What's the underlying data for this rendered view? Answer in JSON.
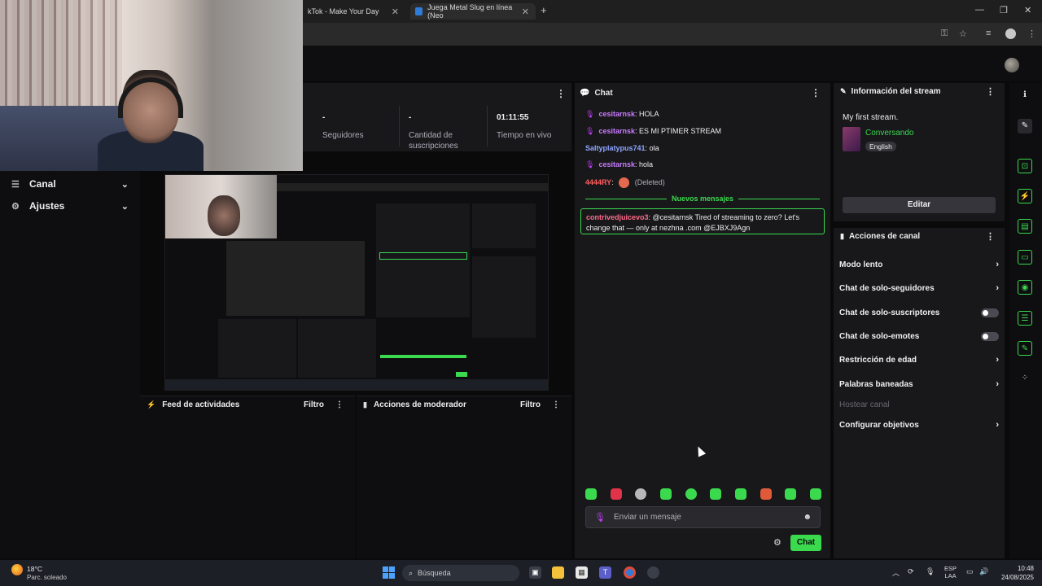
{
  "browser": {
    "tabs": [
      {
        "label": "kTok - Make Your Day"
      },
      {
        "label": "Juega Metal Slug en línea (Neo"
      }
    ],
    "new_tab": "+",
    "close_glyph": "✕",
    "controls": {
      "minimize": "—",
      "maximize": "❐",
      "close": "✕"
    }
  },
  "left_sidebar": {
    "items": [
      {
        "label": "Canal",
        "icon": "channel-icon"
      },
      {
        "label": "Ajustes",
        "icon": "settings-icon"
      }
    ]
  },
  "stats": {
    "items": [
      {
        "value": "-",
        "label": "Seguidores"
      },
      {
        "value": "-",
        "label": "Cantidad de suscripciones"
      },
      {
        "value": "01:11:55",
        "label": "Tiempo en vivo"
      }
    ]
  },
  "activity_feed": {
    "title": "Feed de actividades",
    "filter": "Filtro"
  },
  "mod_actions": {
    "title": "Acciones de moderador",
    "filter": "Filtro"
  },
  "chat": {
    "title": "Chat",
    "messages": [
      {
        "user": "cesitarnsk",
        "text": "HOLA",
        "color": "#c97bff",
        "badge": "mic"
      },
      {
        "user": "cesitarnsk",
        "text": "ES MI PTIMER STREAM",
        "color": "#c97bff",
        "badge": "mic"
      },
      {
        "user": "Saltyplatypus741",
        "text": "ola",
        "color": "#8fa6ff",
        "badge": ""
      },
      {
        "user": "cesitarnsk",
        "text": "hola",
        "color": "#c97bff",
        "badge": "mic"
      },
      {
        "user": "4444RY",
        "text": "(Deleted)",
        "color": "#ff5f5f",
        "badge": ""
      }
    ],
    "new_messages_label": "Nuevos mensajes",
    "highlighted": {
      "user": "contrivedjuicevo3",
      "text": "@cesitarnsk Tired of streaming to zero? Let's change that — only at nezhna .com @EJBXJ9Agn"
    },
    "input_placeholder": "Enviar un mensaje",
    "send_label": "Chat",
    "emote_count": 10
  },
  "stream_info": {
    "title": "Información del stream",
    "stream_title": "My first stream.",
    "category": "Conversando",
    "language": "English",
    "edit_label": "Editar"
  },
  "channel_actions": {
    "title": "Acciones de canal",
    "items": [
      {
        "label": "Modo lento",
        "control": "chevron"
      },
      {
        "label": "Chat de solo-seguidores",
        "control": "chevron"
      },
      {
        "label": "Chat de solo-suscriptores",
        "control": "toggle",
        "on": false
      },
      {
        "label": "Chat de solo-emotes",
        "control": "toggle",
        "on": false
      },
      {
        "label": "Restricción de edad",
        "control": "chevron"
      },
      {
        "label": "Palabras baneadas",
        "control": "chevron"
      },
      {
        "label": "Hostear canal",
        "control": "disabled"
      },
      {
        "label": "Configurar objetivos",
        "control": "chevron"
      }
    ]
  },
  "taskbar": {
    "weather_temp": "18°C",
    "weather_desc": "Parc. soleado",
    "search_placeholder": "Búsqueda",
    "lang_top": "ESP",
    "lang_bottom": "LAA",
    "time": "10:48",
    "date": "24/08/2025"
  },
  "colors": {
    "accent": "#3ad94e",
    "mod_badge": "#c43cff",
    "panel": "#18181b",
    "bg": "#0e0e10"
  }
}
